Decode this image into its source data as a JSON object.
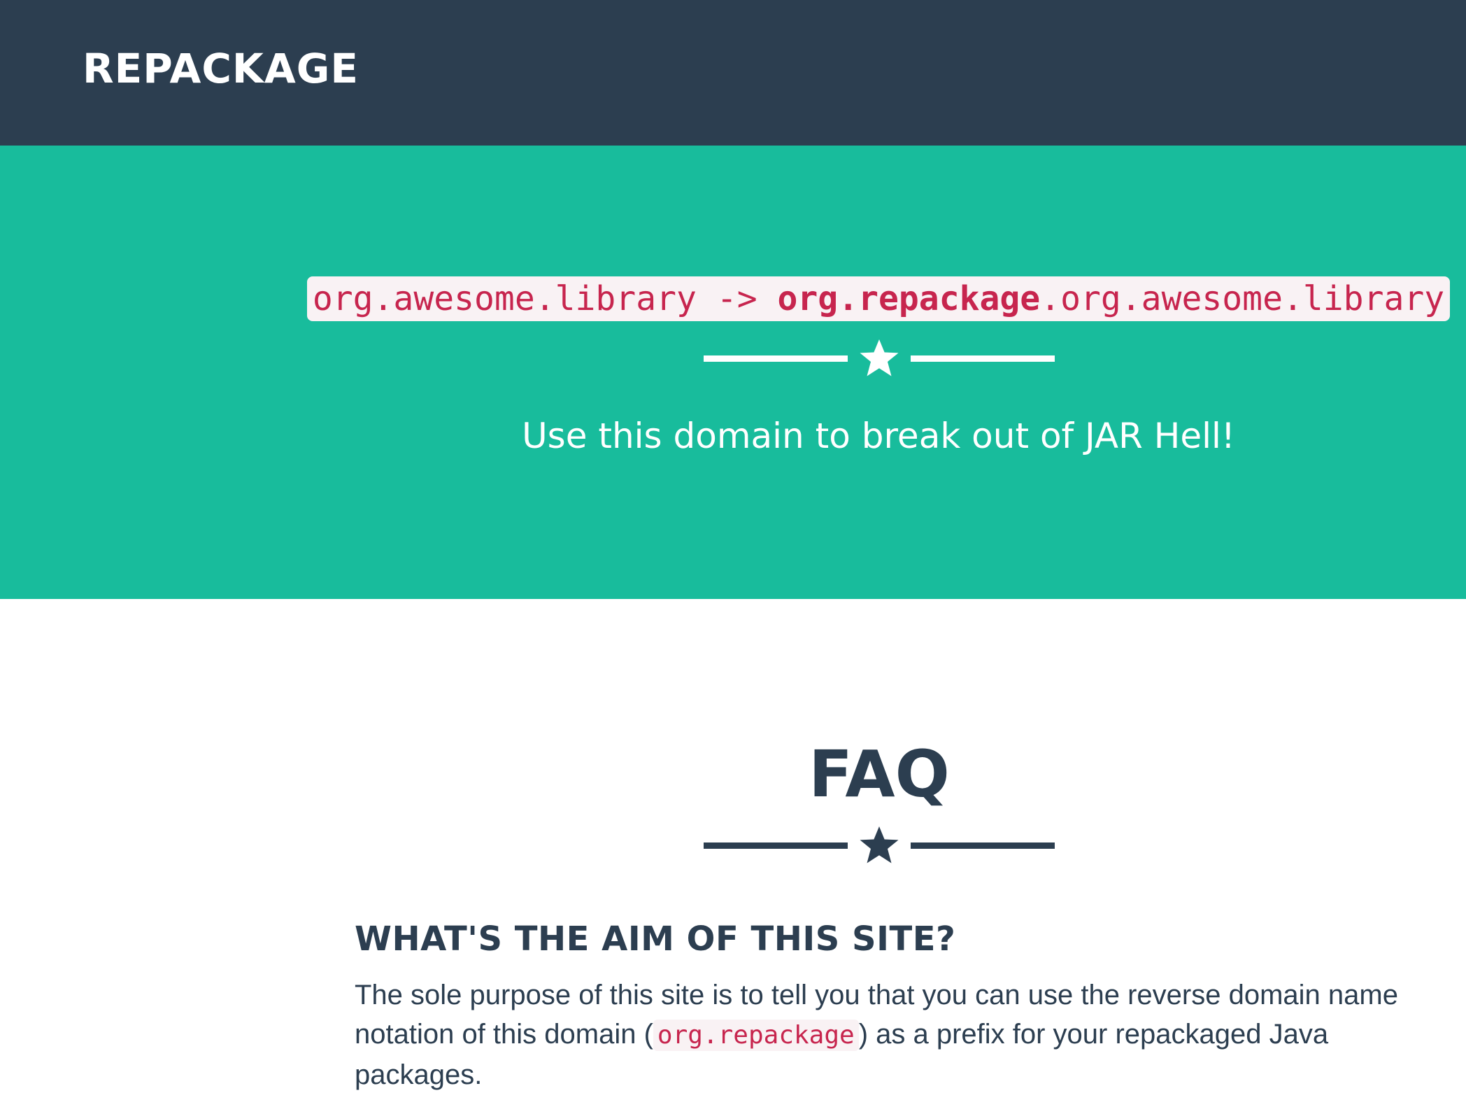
{
  "navbar": {
    "brand": "REPACKAGE",
    "background": "#2c3e50"
  },
  "hero": {
    "background": "#18bc9c",
    "code_original": "org.awesome.library",
    "code_arrow": " -> ",
    "code_prefix": "org.repackage",
    "code_suffix": ".org.awesome.library",
    "divider_icon": "star-icon",
    "tagline": "Use this domain to break out of JAR Hell!"
  },
  "faq": {
    "title": "FAQ",
    "divider_icon": "star-icon",
    "items": [
      {
        "question": "WHAT'S THE AIM OF THIS SITE?",
        "answer_before": "The sole purpose of this site is to tell you that you can use the reverse domain name notation of this domain (",
        "answer_code": "org.repackage",
        "answer_after": ") as a prefix for your repackaged Java packages."
      }
    ]
  },
  "colors": {
    "code_text": "#c7254e",
    "code_background": "#f9f2f4",
    "heading_text": "#2c3e50"
  }
}
